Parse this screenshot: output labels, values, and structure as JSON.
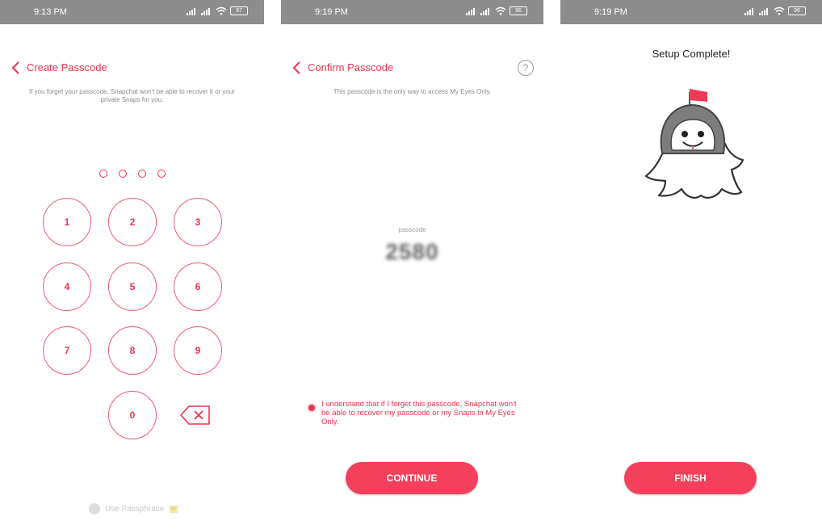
{
  "colors": {
    "accent": "#e8344f",
    "button": "#f4405a",
    "status_bar": "#8d8d8d"
  },
  "screen1": {
    "status": {
      "time": "9:13 PM",
      "battery": "97"
    },
    "title": "Create Passcode",
    "subtitle": "If you forget your passcode, Snapchat won't be able to recover it or your private Snaps for you.",
    "keys": [
      "1",
      "2",
      "3",
      "4",
      "5",
      "6",
      "7",
      "8",
      "9",
      "0"
    ],
    "passphrase_label": "Use Passphrase"
  },
  "screen2": {
    "status": {
      "time": "9:19 PM",
      "battery": "96"
    },
    "title": "Confirm Passcode",
    "help_glyph": "?",
    "subtitle": "This passcode is the only way to access My Eyes Only.",
    "passcode_label": "passcode",
    "passcode_value": "2580",
    "understand_text": "I understand that if I forget this passcode, Snapchat won't be able to recover my passcode or my Snaps in My Eyes Only.",
    "continue_label": "CONTINUE"
  },
  "screen3": {
    "status": {
      "time": "9:19 PM",
      "battery": "96"
    },
    "title": "Setup Complete!",
    "finish_label": "FINISH"
  }
}
